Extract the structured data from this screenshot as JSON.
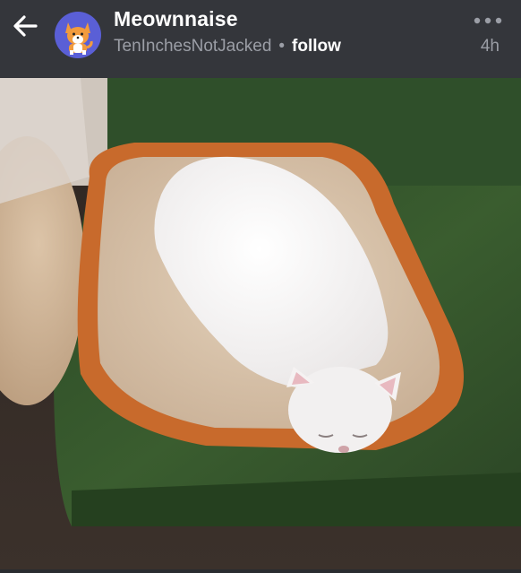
{
  "header": {
    "title": "Meownnaise",
    "username": "TenInchesNotJacked",
    "separator": "•",
    "follow_label": "follow",
    "age": "4h",
    "back_icon": "back-arrow-icon",
    "more_icon": "more-dots-icon",
    "avatar_icon": "corgi-avatar"
  },
  "colors": {
    "header_bg": "#34363b",
    "avatar_bg": "#5a5fd6",
    "secondary_text": "#9b9ea6"
  }
}
